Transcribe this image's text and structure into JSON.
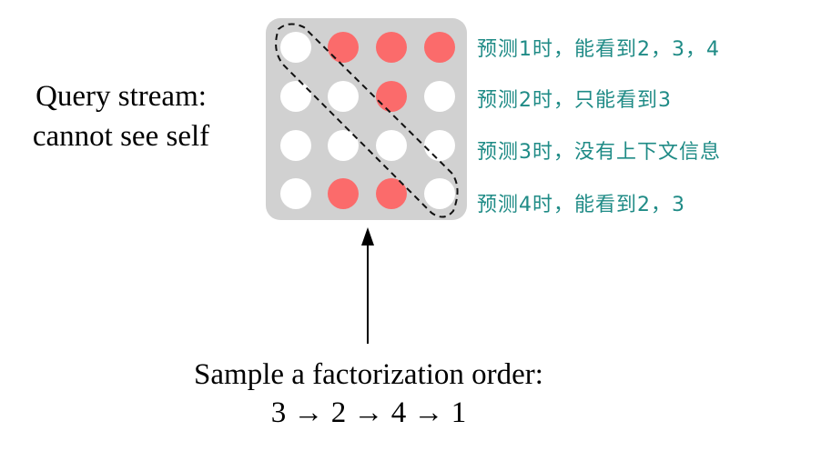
{
  "left_label": {
    "line1": "Query stream:",
    "line2": "cannot see self"
  },
  "matrix": {
    "colors": {
      "background": "#d1d1d1",
      "visible": "#fb6b6b",
      "hidden": "#ffffff"
    },
    "rows": [
      [
        "hidden",
        "visible",
        "visible",
        "visible"
      ],
      [
        "hidden",
        "hidden",
        "visible",
        "hidden"
      ],
      [
        "hidden",
        "hidden",
        "hidden",
        "hidden"
      ],
      [
        "hidden",
        "visible",
        "visible",
        "hidden"
      ]
    ]
  },
  "annotations": [
    "预测1时，能看到2，3，4",
    "预测2时，只能看到3",
    "预测3时，没有上下文信息",
    "预测4时，能看到2，3"
  ],
  "annotation_color": "#1f8b86",
  "bottom_label": {
    "line1": "Sample a factorization order:",
    "line2": "3 → 2 → 4 → 1"
  }
}
